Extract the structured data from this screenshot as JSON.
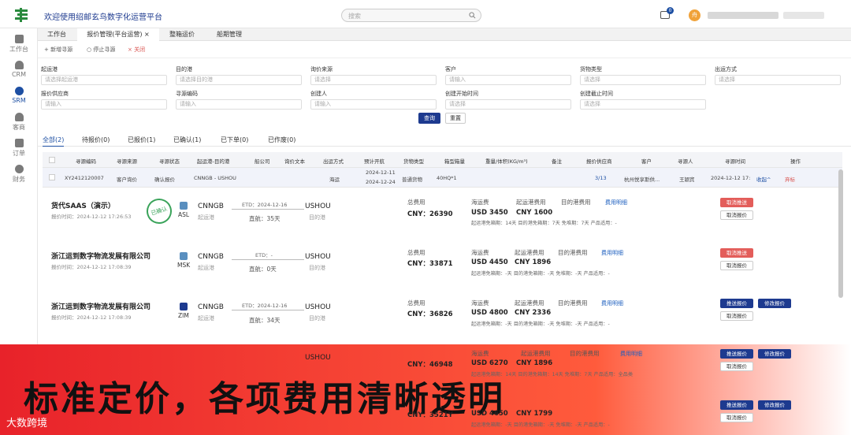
{
  "header": {
    "app_title": "欢迎使用绍邮玄鸟数字化运营平台",
    "search_placeholder": "搜索",
    "message_count": "0",
    "avatar_text": "舟"
  },
  "sidebar": {
    "items": [
      {
        "label": "工作台"
      },
      {
        "label": "CRM"
      },
      {
        "label": "SRM"
      },
      {
        "label": "客商"
      },
      {
        "label": "订单"
      },
      {
        "label": "财务"
      }
    ]
  },
  "tabs": [
    {
      "label": "工作台"
    },
    {
      "label": "报价管理(平台运营)",
      "close": "×"
    },
    {
      "label": "整箱运价"
    },
    {
      "label": "船期管理"
    }
  ],
  "toolbar": {
    "new": "+ 新增寻源",
    "stop": "停止寻源",
    "close": "× 关闭"
  },
  "filters": {
    "row1": [
      {
        "label": "起运港",
        "placeholder": "请选择起运港"
      },
      {
        "label": "目的港",
        "placeholder": "请选择目的港"
      },
      {
        "label": "询价来源",
        "placeholder": "请选择"
      },
      {
        "label": "客户",
        "placeholder": "请输入"
      },
      {
        "label": "货物类型",
        "placeholder": "请选择"
      },
      {
        "label": "出运方式",
        "placeholder": "请选择"
      }
    ],
    "row2": [
      {
        "label": "报价供应商",
        "placeholder": "请输入"
      },
      {
        "label": "寻源编码",
        "placeholder": "请输入"
      },
      {
        "label": "创建人",
        "placeholder": "请输入"
      },
      {
        "label": "创建开始时间",
        "placeholder": "请选择"
      },
      {
        "label": "创建截止时间",
        "placeholder": "请选择"
      }
    ],
    "query": "查询",
    "reset": "重置"
  },
  "status_tabs": [
    {
      "label": "全部(2)"
    },
    {
      "label": "待报价(0)"
    },
    {
      "label": "已报价(1)"
    },
    {
      "label": "已确认(1)"
    },
    {
      "label": "已下单(0)"
    },
    {
      "label": "已作废(0)"
    }
  ],
  "table": {
    "headers": [
      "寻源编码",
      "寻源来源",
      "寻源状态",
      "起运港-目的港",
      "船公司",
      "询价文本",
      "出运方式",
      "预计开航",
      "货物类型",
      "箱型箱量",
      "重量/体积(KG/m³)",
      "备注",
      "报价供应商",
      "客户",
      "寻源人",
      "寻源时间",
      "操作"
    ],
    "row": {
      "code": "XY2412120007",
      "source": "客户询价",
      "status": "确认报价",
      "route": "CNNGB - USHOU",
      "shipping_mode": "海运",
      "sail_start": "2024-12-11",
      "sail_end": "2024-12-24",
      "cargo": "普通货物",
      "container": "40HQ*1",
      "supplier": "3/13",
      "customer": "杭州悦享斯供...",
      "creator": "王颖宾",
      "time": "2024-12-12 17:",
      "collapse": "收起",
      "trash": "弃标"
    }
  },
  "quotes": [
    {
      "company": "货代SAAS（演示）",
      "time": "报价时间：2024-12-12 17:26:53",
      "stamp": "已确认",
      "carrier": "ASL",
      "pol": "CNNGB",
      "pol_sub": "起运港",
      "etd": "ETD：2024-12-16",
      "duration": "直航：35天",
      "pod": "USHOU",
      "pod_sub": "目的港",
      "total_label": "总费用",
      "total": "CNY：26390",
      "sea_label": "海运费",
      "sea": "USD 3450",
      "pol_fee_label": "起运港费用",
      "pol_fee": "CNY 1600",
      "pod_fee_label": "目的港费用",
      "detail": "费用明细",
      "free": "起运港免箱期：14天   目的港免箱期：7天   免堆期：7天   产品适用：-",
      "btn1": "取消推送",
      "btn2": "取消报价"
    },
    {
      "company": "浙江运到数字物流发展有限公司",
      "time": "报价时间：2024-12-12 17:08:39",
      "carrier": "MSK",
      "pol": "CNNGB",
      "pol_sub": "起运港",
      "etd": "ETD：-",
      "duration": "直航：0天",
      "pod": "USHOU",
      "pod_sub": "目的港",
      "total_label": "总费用",
      "total": "CNY：33871",
      "sea_label": "海运费",
      "sea": "USD 4450",
      "pol_fee_label": "起运港费用",
      "pol_fee": "CNY 1896",
      "pod_fee_label": "目的港费用",
      "detail": "费用明细",
      "free": "起运港免箱期：-天   目的港免箱期：-天   免堆期：-天   产品适用：-",
      "btn1": "取消推送",
      "btn2": "取消报价"
    },
    {
      "company": "浙江运到数字物流发展有限公司",
      "time": "报价时间：2024-12-12 17:08:39",
      "carrier": "ZIM",
      "pol": "CNNGB",
      "pol_sub": "起运港",
      "etd": "ETD：2024-12-16",
      "duration": "直航：34天",
      "pod": "USHOU",
      "pod_sub": "目的港",
      "total_label": "总费用",
      "total": "CNY：36826",
      "sea_label": "海运费",
      "sea": "USD 4800",
      "pol_fee_label": "起运港费用",
      "pol_fee": "CNY 2336",
      "pod_fee_label": "目的港费用",
      "detail": "费用明细",
      "free": "起运港免箱期：-天   目的港免箱期：-天   免堆期：-天   产品适用：-",
      "btn1": "推送报价",
      "btn2": "修改报价",
      "btn3": "取消报价"
    },
    {
      "pod": "USHOU",
      "total": "CNY：46948",
      "sea_label": "海运费",
      "sea": "USD 6270",
      "pol_fee_label": "起运港费用",
      "pol_fee": "CNY 1896",
      "pod_fee_label": "目的港费用",
      "detail": "费用明细",
      "free": "起运港免箱期：14天   目的港免箱期：14天   免堆期：7天   产品适用：全品类",
      "btn1": "推送报价",
      "btn2": "修改报价",
      "btn3": "取消报价"
    },
    {
      "total": "CNY：3521Y",
      "sea": "USD 4650",
      "pol_fee": "CNY 1799",
      "free": "起运港免箱期：-天   目的港免箱期：-天   免堆期：-天   产品适用：-",
      "btn1": "推送报价",
      "btn2": "修改报价",
      "btn3": "取消报价"
    }
  ],
  "banner": {
    "text": "标准定价，各项费用清晰透明",
    "brand": "大数跨境"
  }
}
